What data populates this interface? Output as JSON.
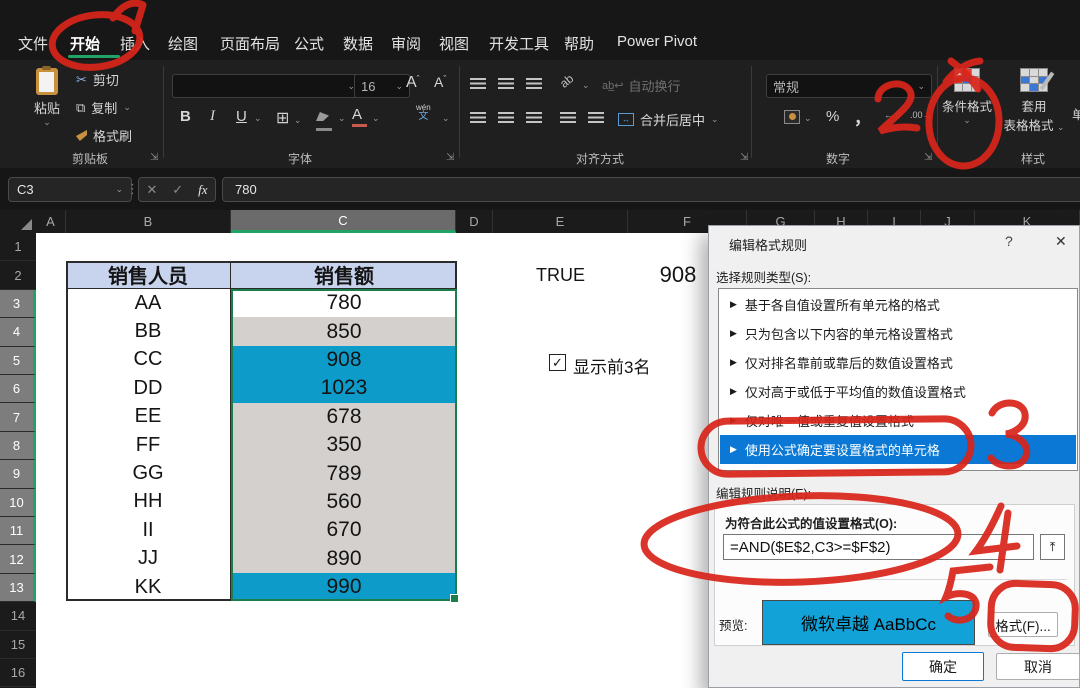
{
  "menu": {
    "items": [
      "文件",
      "开始",
      "插入",
      "绘图",
      "页面布局",
      "公式",
      "数据",
      "审阅",
      "视图",
      "开发工具",
      "帮助",
      "Power Pivot"
    ],
    "active": "开始"
  },
  "ribbon": {
    "clipboard": {
      "paste": "粘贴",
      "cut": "剪切",
      "copy": "复制",
      "format_painter": "格式刷",
      "group": "剪贴板"
    },
    "font": {
      "size": "16",
      "bold": "B",
      "italic": "I",
      "underline": "U",
      "grow": "A",
      "shrink": "A",
      "phonetic_top": "wén",
      "phonetic_bottom": "文",
      "group": "字体"
    },
    "alignment": {
      "wrap": "自动换行",
      "merge": "合并后居中",
      "group": "对齐方式"
    },
    "number": {
      "format": "常规",
      "percent": "%",
      "comma": "，",
      "inc_decimal": "←.0",
      "dec_decimal": ".00→",
      "group": "数字"
    },
    "styles": {
      "conditional": "条件格式",
      "table_format_1": "套用",
      "table_format_2": "表格格式",
      "cell_styles_clipped": "单",
      "group": "样式"
    }
  },
  "formula_bar": {
    "name_box": "C3",
    "cancel": "✕",
    "enter": "✓",
    "fx": "fx",
    "value": "780"
  },
  "sheet": {
    "columns": [
      "A",
      "B",
      "C",
      "D",
      "E",
      "F",
      "G",
      "H",
      "I",
      "J",
      "K"
    ],
    "active_column": "C",
    "row_numbers": [
      "1",
      "2",
      "3",
      "4",
      "5",
      "6",
      "7",
      "8",
      "9",
      "10",
      "11",
      "12",
      "13",
      "14",
      "15",
      "16"
    ],
    "highlighted_rows": [
      3,
      4,
      5,
      6,
      7,
      8,
      9,
      10,
      11,
      12,
      13
    ],
    "table": {
      "headers": [
        "销售人员",
        "销售额"
      ],
      "rows": [
        {
          "name": "AA",
          "value": "780",
          "fill": "none"
        },
        {
          "name": "BB",
          "value": "850",
          "fill": "gray"
        },
        {
          "name": "CC",
          "value": "908",
          "fill": "teal"
        },
        {
          "name": "DD",
          "value": "1023",
          "fill": "teal"
        },
        {
          "name": "EE",
          "value": "678",
          "fill": "gray"
        },
        {
          "name": "FF",
          "value": "350",
          "fill": "gray"
        },
        {
          "name": "GG",
          "value": "789",
          "fill": "gray"
        },
        {
          "name": "HH",
          "value": "560",
          "fill": "gray"
        },
        {
          "name": "II",
          "value": "670",
          "fill": "gray"
        },
        {
          "name": "JJ",
          "value": "890",
          "fill": "gray"
        },
        {
          "name": "KK",
          "value": "990",
          "fill": "teal"
        }
      ]
    },
    "e2_value": "TRUE",
    "f2_value": "908",
    "checkbox_label": "显示前3名",
    "checkbox_checked": true
  },
  "dialog": {
    "title": "编辑格式规则",
    "help": "?",
    "close": "✕",
    "rule_type_label": "选择规则类型(S):",
    "rules": [
      "基于各自值设置所有单元格的格式",
      "只为包含以下内容的单元格设置格式",
      "仅对排名靠前或靠后的数值设置格式",
      "仅对高于或低于平均值的数值设置格式",
      "仅对唯一值或重复值设置格式",
      "使用公式确定要设置格式的单元格"
    ],
    "selected_rule_index": 5,
    "desc_label": "编辑规则说明(E):",
    "formula_label": "为符合此公式的值设置格式(O):",
    "formula": "=AND($E$2,C3>=$F$2)",
    "collapse_icon": "⤒",
    "preview_label": "预览:",
    "preview_text": "微软卓越 AaBbCc",
    "format_button": "格式(F)...",
    "ok_button": "确定",
    "cancel_button": "取消"
  },
  "annotations": {
    "steps": [
      "1",
      "2",
      "3",
      "4",
      "5"
    ],
    "color": "#d9251a"
  },
  "colors": {
    "accent_blue": "#0a78d4",
    "cond_format_fill": "#0d9bca",
    "selection_gray": "#d3d0cd",
    "table_header_fill": "#c8d4ee",
    "excel_green": "#21a366",
    "annotation_red": "#d9251a",
    "preview_fill": "#12a2d8"
  }
}
